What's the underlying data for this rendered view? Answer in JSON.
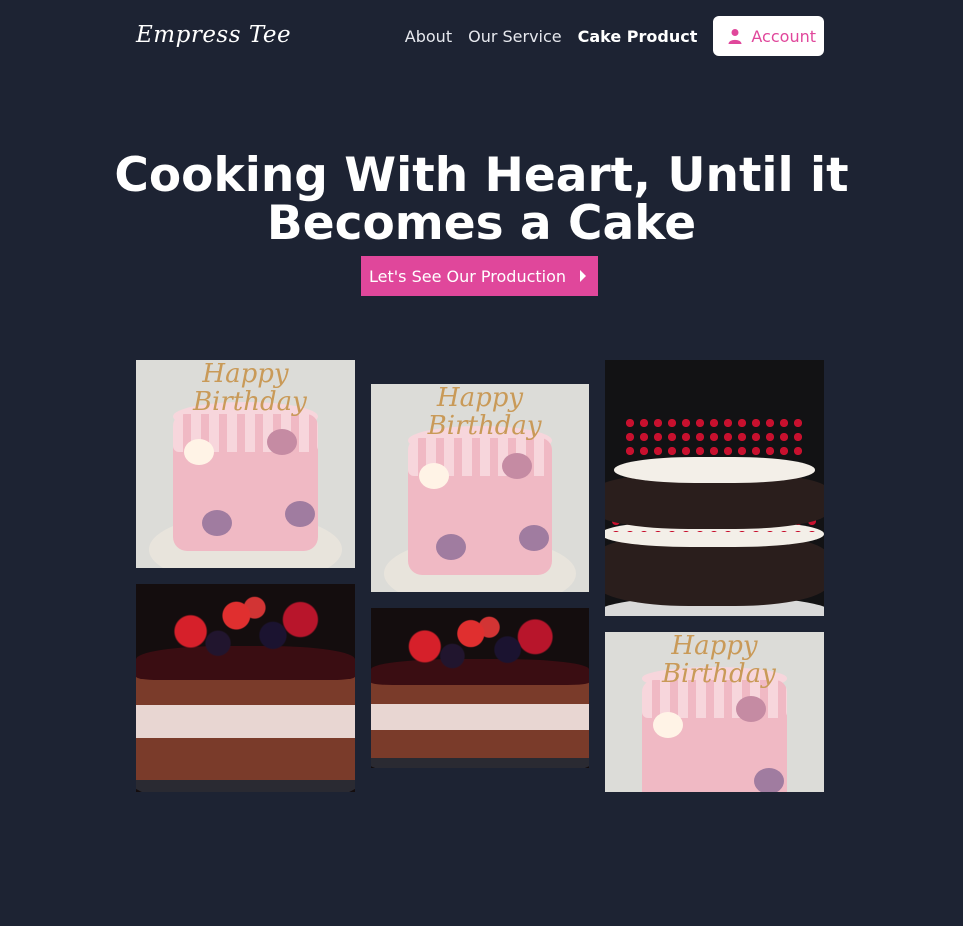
{
  "nav": {
    "logo": "Empress Tee",
    "links": [
      {
        "label": "About",
        "active": false
      },
      {
        "label": "Our Service",
        "active": false
      },
      {
        "label": "Cake Product",
        "active": true
      }
    ],
    "account_label": "Account",
    "account_icon": "user-icon"
  },
  "hero": {
    "title": "Cooking With Heart, Until it Becomes a Cake",
    "cta_label": "Let's See Our Production",
    "cta_icon": "caret-right-icon"
  },
  "gallery": {
    "images": [
      {
        "name": "pink-birthday-cake",
        "topper_text": "Happy Birthday"
      },
      {
        "name": "pink-birthday-cake",
        "topper_text": "Happy Birthday"
      },
      {
        "name": "chocolate-cherry-layer-cake"
      },
      {
        "name": "chocolate-berry-cake"
      },
      {
        "name": "chocolate-berry-cake"
      },
      {
        "name": "pink-birthday-cake",
        "topper_text": "Happy Birthday"
      }
    ]
  },
  "colors": {
    "background": "#1d2333",
    "accent": "#e0479b",
    "text": "#ffffff"
  }
}
